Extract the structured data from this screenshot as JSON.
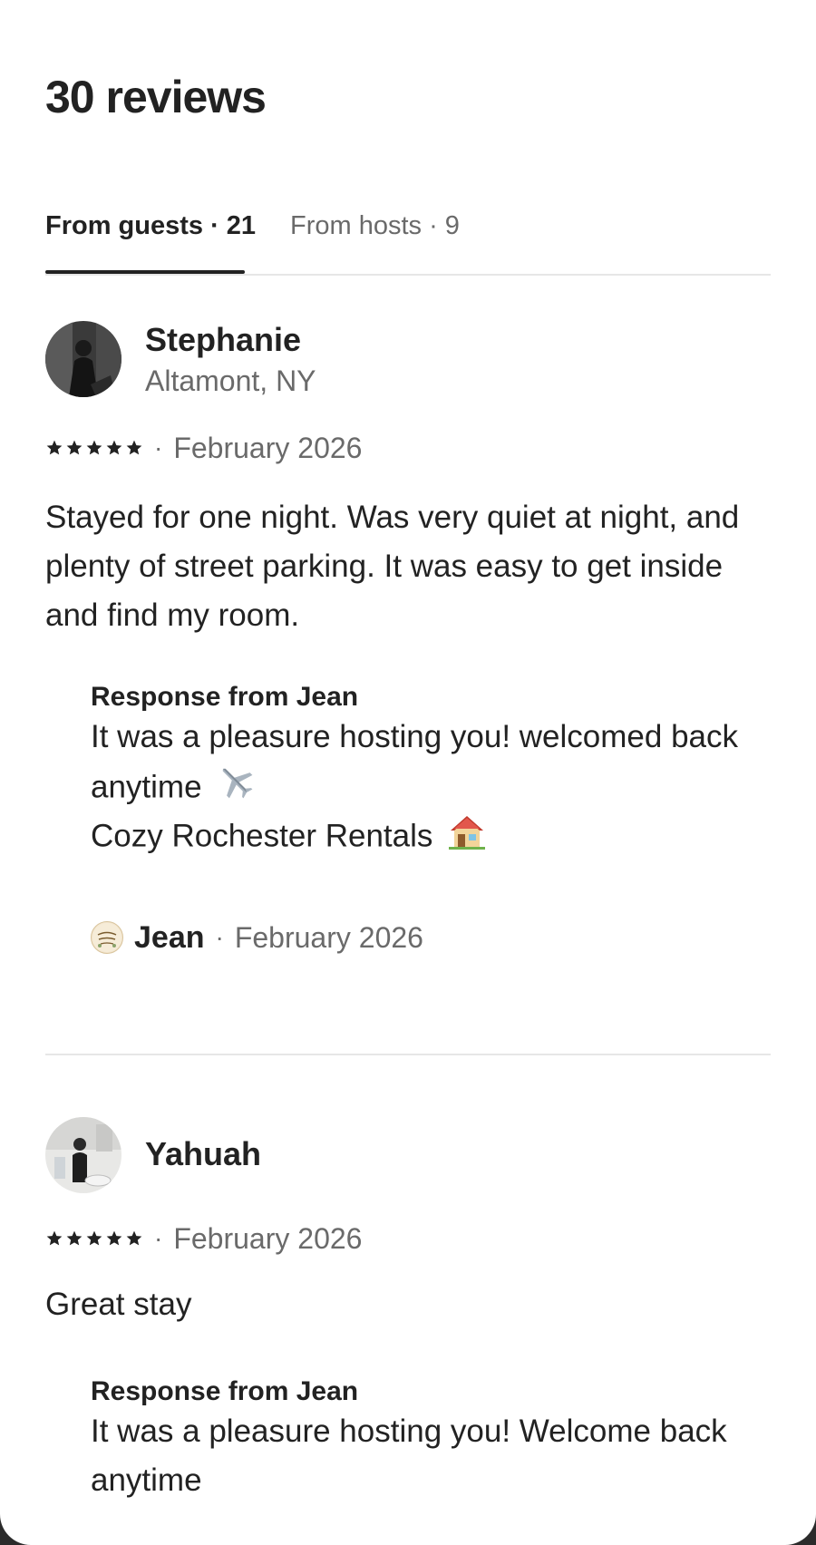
{
  "page": {
    "title": "30 reviews"
  },
  "tabs": [
    {
      "label": "From guests · 21"
    },
    {
      "label": "From hosts · 9"
    }
  ],
  "reviews": [
    {
      "name": "Stephanie",
      "location": "Altamont, NY",
      "rating": 5,
      "date": "February 2026",
      "text": "Stayed for one night. Was very quiet at night, and plenty of street parking. It was easy to get inside and find my room.",
      "response": {
        "title": "Response from Jean",
        "line1": "It was a pleasure hosting you! welcomed back anytime",
        "line1_emoji": "airplane-icon",
        "line2": "Cozy Rochester Rentals",
        "line2_emoji": "house-icon",
        "author": "Jean",
        "date": "February 2026"
      }
    },
    {
      "name": "Yahuah",
      "rating": 5,
      "date": "February 2026",
      "text": "Great stay",
      "response": {
        "title": "Response from Jean",
        "line1": "It was a pleasure hosting you! Welcome back anytime"
      }
    }
  ],
  "separator": "·",
  "colors": {
    "text": "#222222",
    "muted": "#6a6a6a",
    "divider": "#e6e6e6"
  }
}
